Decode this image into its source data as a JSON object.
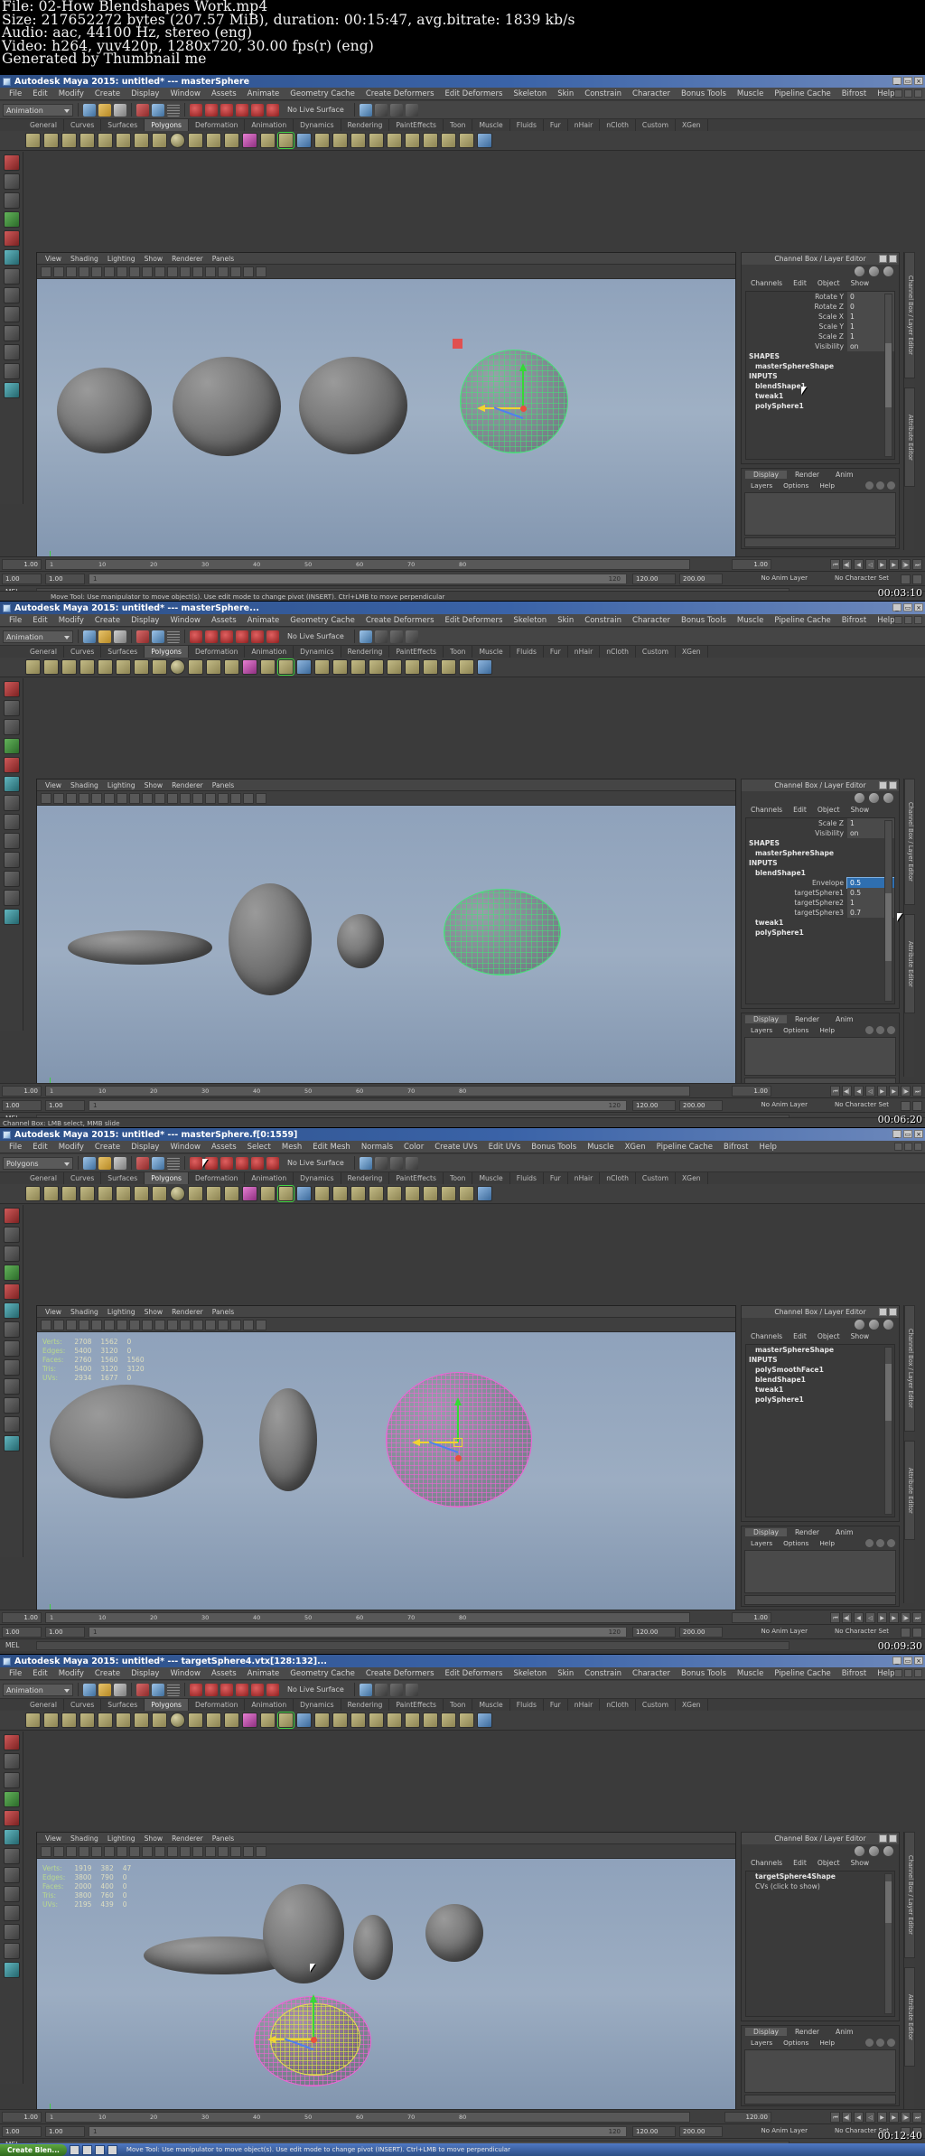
{
  "header": {
    "lines": [
      "File: 02-How Blendshapes Work.mp4",
      "Size: 217652272 bytes (207.57 MiB), duration: 00:15:47, avg.bitrate: 1839 kb/s",
      "Audio: aac, 44100 Hz, stereo (eng)",
      "Video: h264, yuv420p, 1280x720, 30.00 fps(r) (eng)",
      "Generated by Thumbnail me"
    ]
  },
  "common": {
    "menu_items": [
      "File",
      "Edit",
      "Modify",
      "Create",
      "Display",
      "Window",
      "Assets",
      "Animate",
      "Geometry Cache",
      "Create Deformers",
      "Edit Deformers",
      "Skeleton",
      "Skin",
      "Constrain",
      "Character",
      "Bonus Tools",
      "Muscle",
      "Pipeline Cache",
      "Bifrost",
      "Help"
    ],
    "menu_items_modeling": [
      "File",
      "Edit",
      "Modify",
      "Create",
      "Display",
      "Window",
      "Assets",
      "Select",
      "Mesh",
      "Edit Mesh",
      "Normals",
      "Color",
      "Create UVs",
      "Edit UVs",
      "Bonus Tools",
      "Muscle",
      "XGen",
      "Pipeline Cache",
      "Bifrost",
      "Help"
    ],
    "shelf_tabs": [
      "General",
      "Curves",
      "Surfaces",
      "Polygons",
      "Deformation",
      "Animation",
      "Dynamics",
      "Rendering",
      "PaintEffects",
      "Toon",
      "Muscle",
      "Fluids",
      "Fur",
      "nHair",
      "nCloth",
      "Custom",
      "XGen"
    ],
    "shelf_active": "Polygons",
    "viewport_menus": [
      "View",
      "Shading",
      "Lighting",
      "Show",
      "Renderer",
      "Panels"
    ],
    "live_surface": "No Live Surface",
    "anim_mode": "Animation",
    "channelbox_title": "Channel Box / Layer Editor",
    "channelbox_menus": [
      "Channels",
      "Edit",
      "Object",
      "Show"
    ],
    "layer_tabs": [
      "Display",
      "Render",
      "Anim"
    ],
    "layer_menus": [
      "Layers",
      "Options",
      "Help"
    ],
    "right_tabs": [
      "Channel Box / Layer Editor",
      "Attribute Editor"
    ],
    "mel_label": "MEL",
    "anim_layer_label": "No Anim Layer",
    "character_set_label": "No Character Set",
    "help_move_tool": "Move Tool: Use manipulator to move object(s). Use edit mode to change pivot (INSERT).   Ctrl+LMB to move perpendicular",
    "timeline_start": "1.00",
    "timeline_end": "120.00",
    "range_end": "200.00",
    "frame_120": "120"
  },
  "shots": [
    {
      "title": "Autodesk Maya 2015: untitled*     ---     masterSphere",
      "timestamp": "00:03:10",
      "menu_kind": "animation",
      "mode": "Animation",
      "statusbar": "",
      "channel": {
        "attrs": [
          {
            "name": "Rotate Y",
            "value": "0"
          },
          {
            "name": "Rotate Z",
            "value": "0"
          },
          {
            "name": "Scale X",
            "value": "1"
          },
          {
            "name": "Scale Y",
            "value": "1"
          },
          {
            "name": "Scale Z",
            "value": "1"
          },
          {
            "name": "Visibility",
            "value": "on"
          }
        ],
        "sections": [
          {
            "label": "SHAPES",
            "kind": "hdr"
          },
          {
            "label": "masterSphereShape",
            "kind": "node"
          },
          {
            "label": "INPUTS",
            "kind": "hdr"
          },
          {
            "label": "blendShape1",
            "kind": "node"
          },
          {
            "label": "tweak1",
            "kind": "node"
          },
          {
            "label": "polySphere1",
            "kind": "node"
          }
        ]
      },
      "footer_help": "Move Tool: Use manipulator to move object(s). Use edit mode to change pivot (INSERT).   Ctrl+LMB to move perpendicular",
      "stats": null
    },
    {
      "title": "Autodesk Maya 2015: untitled*     ---     masterSphere...",
      "timestamp": "00:06:20",
      "menu_kind": "animation",
      "mode": "Animation",
      "statusbar": "Channel Box: LMB select, MMB slide",
      "channel": {
        "attrs": [
          {
            "name": "Scale Z",
            "value": "1"
          },
          {
            "name": "Visibility",
            "value": "on"
          }
        ],
        "sections": [
          {
            "label": "SHAPES",
            "kind": "hdr"
          },
          {
            "label": "masterSphereShape",
            "kind": "node"
          },
          {
            "label": "INPUTS",
            "kind": "hdr"
          },
          {
            "label": "blendShape1",
            "kind": "node"
          }
        ],
        "blend_attrs": [
          {
            "name": "Envelope",
            "value": "0.5",
            "editing": true
          },
          {
            "name": "targetSphere1",
            "value": "0.5"
          },
          {
            "name": "targetSphere2",
            "value": "1"
          },
          {
            "name": "targetSphere3",
            "value": "0.7"
          }
        ],
        "tail_sections": [
          {
            "label": "tweak1",
            "kind": "node"
          },
          {
            "label": "polySphere1",
            "kind": "node"
          }
        ]
      },
      "stats": null
    },
    {
      "title": "Autodesk Maya 2015: untitled*     ---     masterSphere.f[0:1559]",
      "timestamp": "00:09:30",
      "menu_kind": "modeling",
      "mode": "Polygons",
      "channel": {
        "attrs": [],
        "sections": [
          {
            "label": "masterSphereShape",
            "kind": "node"
          },
          {
            "label": "INPUTS",
            "kind": "hdr"
          },
          {
            "label": "polySmoothFace1",
            "kind": "node"
          },
          {
            "label": "blendShape1",
            "kind": "node"
          },
          {
            "label": "tweak1",
            "kind": "node"
          },
          {
            "label": "polySphere1",
            "kind": "node"
          }
        ]
      },
      "stats": {
        "rows": [
          {
            "label": "Verts:",
            "a": "2708",
            "b": "1562",
            "c": "0"
          },
          {
            "label": "Edges:",
            "a": "5400",
            "b": "3120",
            "c": "0"
          },
          {
            "label": "Faces:",
            "a": "2760",
            "b": "1560",
            "c": "1560"
          },
          {
            "label": "Tris:",
            "a": "5400",
            "b": "3120",
            "c": "3120"
          },
          {
            "label": "UVs:",
            "a": "2934",
            "b": "1677",
            "c": "0"
          }
        ]
      }
    },
    {
      "title": "Autodesk Maya 2015: untitled*     ---     targetSphere4.vtx[128:132]...",
      "timestamp": "00:12:40",
      "menu_kind": "animation",
      "mode": "Animation",
      "channel": {
        "attrs": [],
        "sections": [
          {
            "label": "targetSphere4Shape",
            "kind": "node"
          },
          {
            "label": "CVs (click to show)",
            "kind": "plain"
          }
        ]
      },
      "stats": {
        "rows": [
          {
            "label": "Verts:",
            "a": "1919",
            "b": "382",
            "c": "47"
          },
          {
            "label": "Edges:",
            "a": "3800",
            "b": "790",
            "c": "0"
          },
          {
            "label": "Faces:",
            "a": "2000",
            "b": "400",
            "c": "0"
          },
          {
            "label": "Tris:",
            "a": "3800",
            "b": "760",
            "c": "0"
          },
          {
            "label": "UVs:",
            "a": "2195",
            "b": "439",
            "c": "0"
          }
        ]
      },
      "footer_help": "Move Tool: Use manipulator to move object(s). Use edit mode to change pivot (INSERT).   Ctrl+LMB to move perpendicular"
    }
  ],
  "taskbar": {
    "start_label": "Create Blen...",
    "help_text": "Move Tool: Use manipulator to move object(s). Use edit mode to change pivot (INSERT).   Ctrl+LMB to move perpendicular"
  }
}
